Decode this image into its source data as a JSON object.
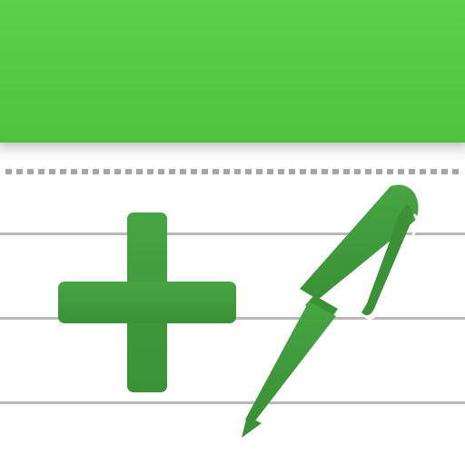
{
  "app_icon": {
    "icon_names": [
      "plus-icon",
      "pen-icon"
    ],
    "colors": {
      "header_green": "#55cc45",
      "glyph_green": "#3e9a3a",
      "rule_gray": "#b9b9b9",
      "paper_white": "#ffffff"
    }
  }
}
